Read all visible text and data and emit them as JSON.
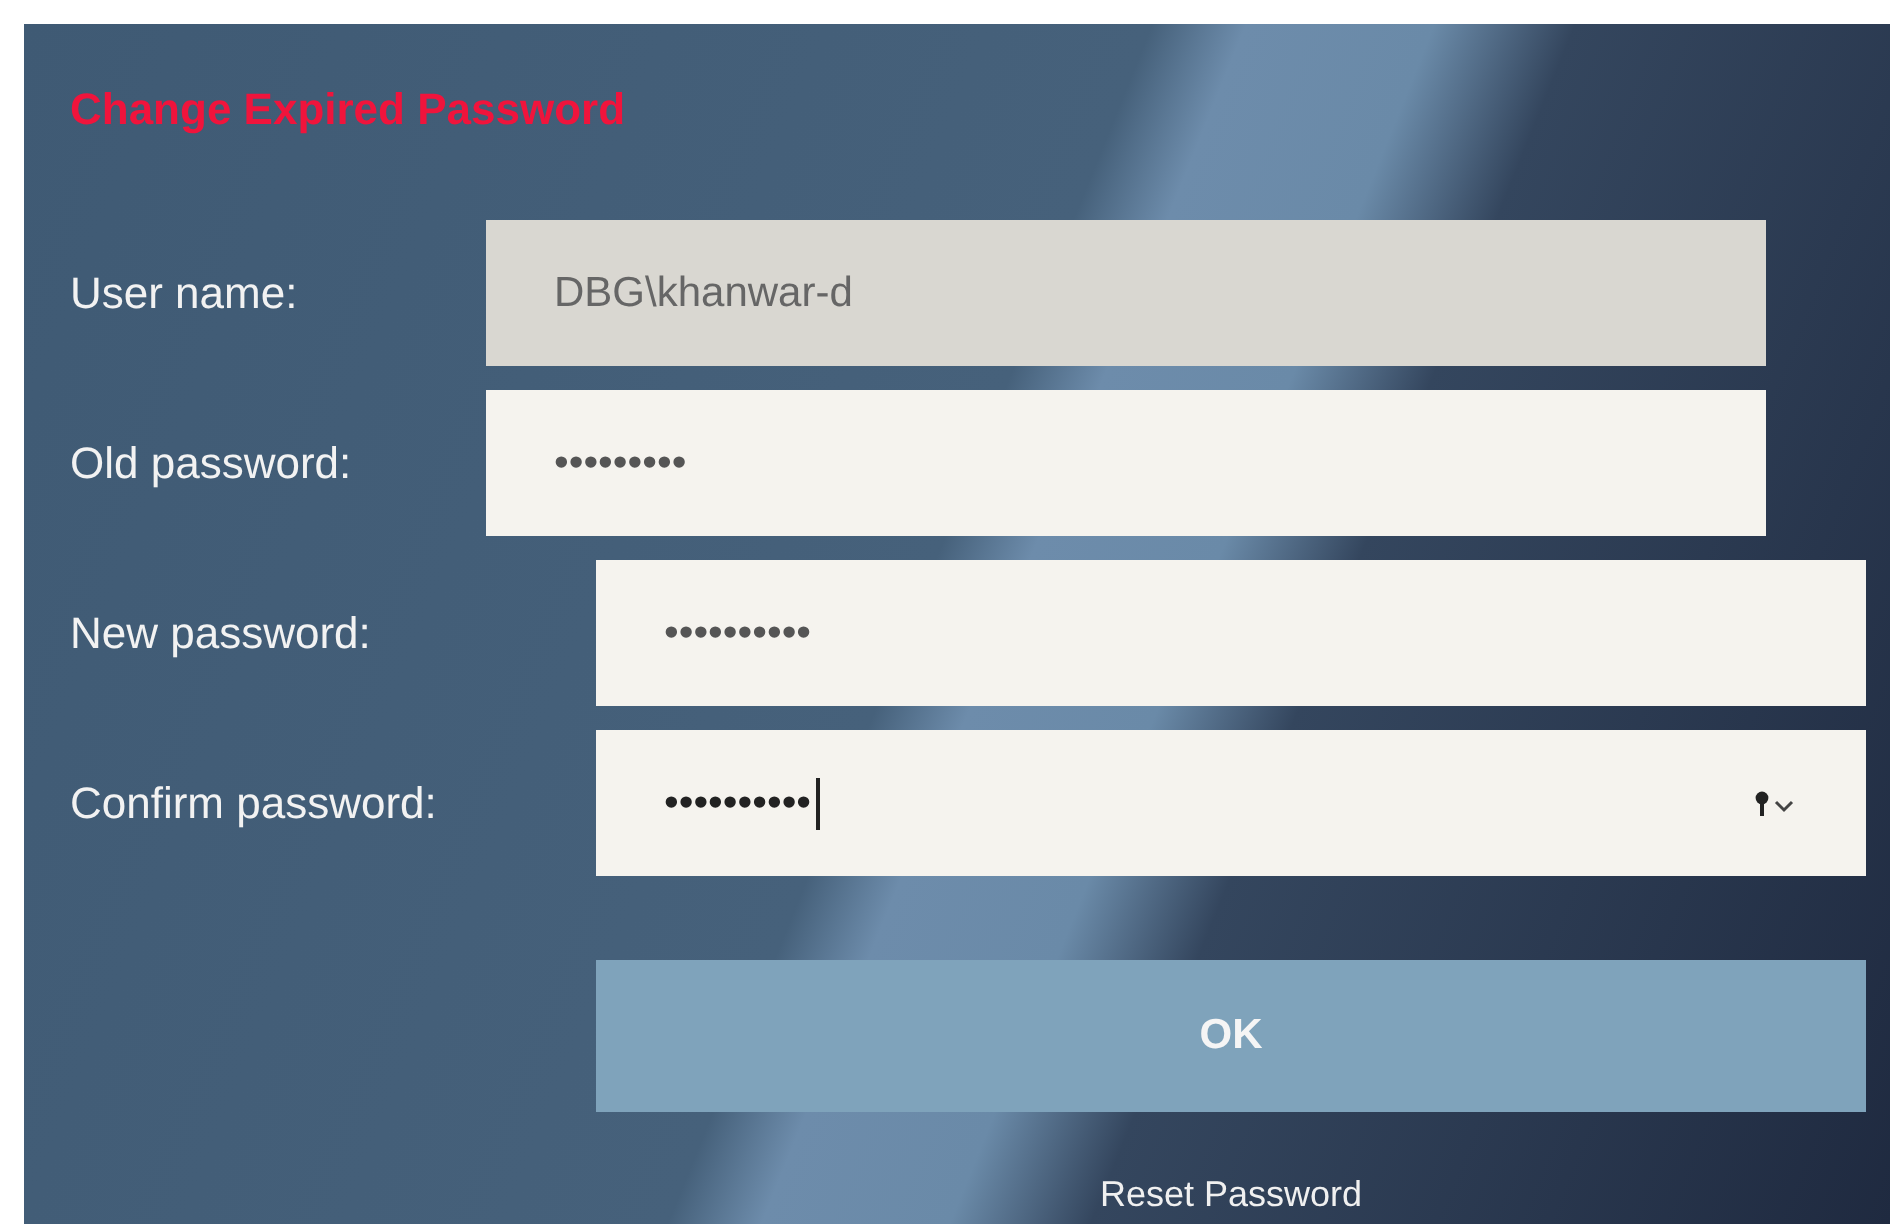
{
  "title": "Change Expired Password",
  "fields": [
    {
      "label": "User name:",
      "value": "DBG\\khanwar-d",
      "disabled": true,
      "focused": false
    },
    {
      "label": "Old password:",
      "value": "•••••••••",
      "disabled": false,
      "focused": false
    },
    {
      "label": "New password:",
      "value": "••••••••••",
      "disabled": false,
      "focused": false
    },
    {
      "label": "Confirm password:",
      "value": "••••••••••",
      "disabled": false,
      "focused": true
    }
  ],
  "ok_button": "OK",
  "reset_link": "Reset Password"
}
